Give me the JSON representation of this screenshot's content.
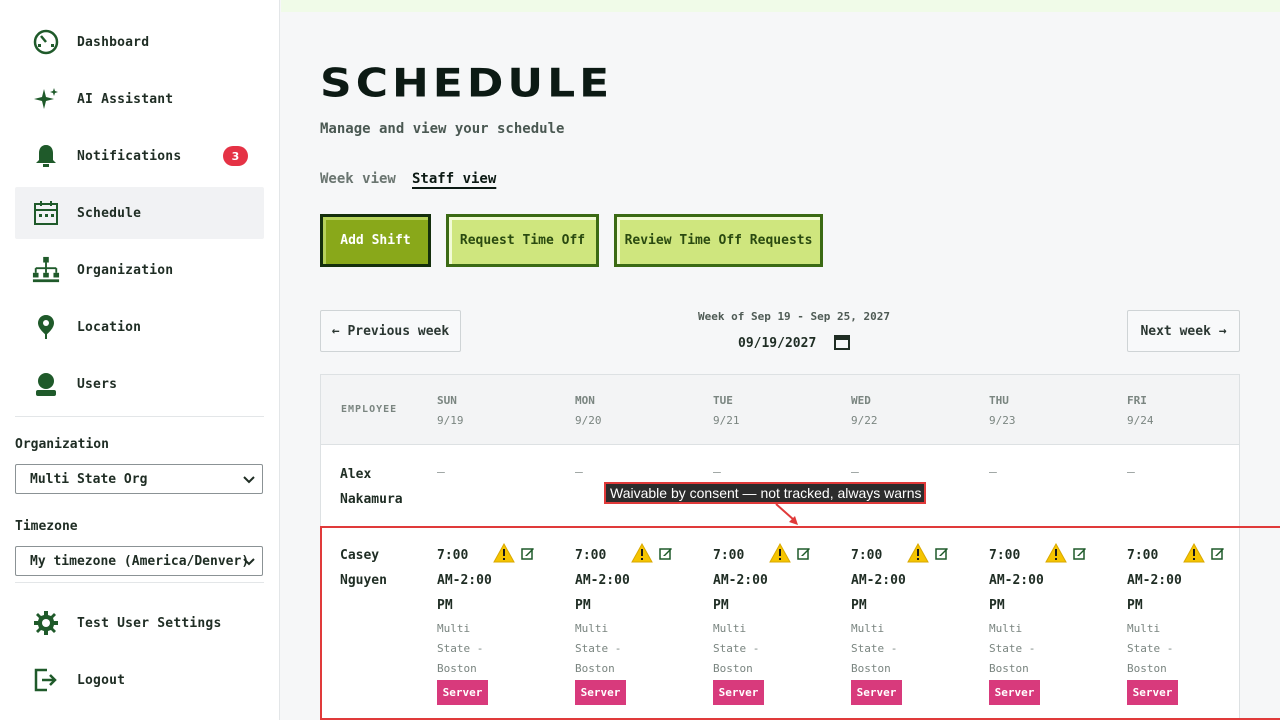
{
  "sidebar": {
    "items": [
      {
        "label": "Dashboard",
        "icon": "dashboard-icon"
      },
      {
        "label": "AI Assistant",
        "icon": "sparkle-icon"
      },
      {
        "label": "Notifications",
        "icon": "bell-icon",
        "badge": "3"
      },
      {
        "label": "Schedule",
        "icon": "calendar-icon",
        "active": true
      },
      {
        "label": "Organization",
        "icon": "org-chart-icon"
      },
      {
        "label": "Location",
        "icon": "location-pin-icon"
      },
      {
        "label": "Users",
        "icon": "user-icon"
      }
    ],
    "organization_label": "Organization",
    "organization_value": "Multi State Org",
    "timezone_label": "Timezone",
    "timezone_value": "My timezone (America/Denver)",
    "footer_items": [
      {
        "label": "Test User Settings",
        "icon": "gear-icon"
      },
      {
        "label": "Logout",
        "icon": "logout-icon"
      }
    ]
  },
  "main": {
    "title": "SCHEDULE",
    "subtitle": "Manage and view your schedule",
    "tabs": [
      {
        "label": "Week view",
        "active": false
      },
      {
        "label": "Staff view",
        "active": true
      }
    ],
    "buttons": {
      "add_shift": "Add Shift",
      "request_time_off": "Request Time Off",
      "review_requests": "Review Time Off Requests"
    },
    "week_nav": {
      "previous": "← Previous week",
      "next": "Next week →",
      "week_label": "Week of Sep 19 - Sep 25, 2027",
      "date_value": "09/19/2027"
    }
  },
  "table": {
    "employee_header": "EMPLOYEE",
    "days": [
      {
        "day": "SUN",
        "date": "9/19"
      },
      {
        "day": "MON",
        "date": "9/20"
      },
      {
        "day": "TUE",
        "date": "9/21"
      },
      {
        "day": "WED",
        "date": "9/22"
      },
      {
        "day": "THU",
        "date": "9/23"
      },
      {
        "day": "FRI",
        "date": "9/24"
      }
    ],
    "rows": [
      {
        "first": "Alex",
        "last": "Nakamura",
        "cells": [
          "—",
          "—",
          "—",
          "—",
          "—",
          "—"
        ]
      },
      {
        "first": "Casey",
        "last": "Nguyen",
        "shift": {
          "time1": "7:00",
          "time2": "AM-2:00",
          "time3": "PM",
          "loc1": "Multi",
          "loc2": "State -",
          "loc3": "Boston",
          "role": "Server"
        }
      }
    ]
  },
  "annotation": {
    "tooltip": "Waivable by consent — not tracked, always warns"
  },
  "colors": {
    "accent_green": "#89a81a",
    "light_green": "#cfe67e",
    "badge_red": "#e53245",
    "role_pink": "#d83a7c",
    "warning_yellow": "#f5c400",
    "highlight_red": "#e03a3a"
  }
}
